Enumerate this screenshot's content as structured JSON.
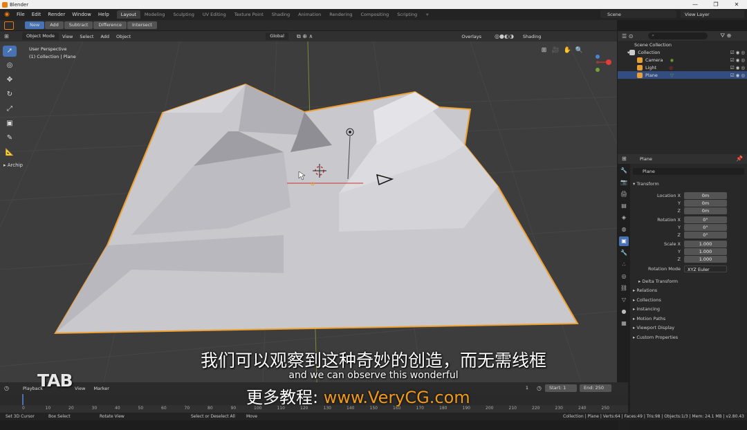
{
  "titlebar": {
    "app_title": "Blender",
    "min": "—",
    "max": "❐",
    "close": "✕"
  },
  "menu": [
    "File",
    "Edit",
    "Render",
    "Window",
    "Help"
  ],
  "workspaces": [
    {
      "label": "Layout",
      "active": true
    },
    {
      "label": "Modeling"
    },
    {
      "label": "Sculpting"
    },
    {
      "label": "UV Editing"
    },
    {
      "label": "Texture Point"
    },
    {
      "label": "Shading"
    },
    {
      "label": "Animation"
    },
    {
      "label": "Rendering"
    },
    {
      "label": "Compositing"
    },
    {
      "label": "Scripting"
    },
    {
      "label": "+"
    }
  ],
  "scene": {
    "label": "Scene",
    "view_layer": "View Layer"
  },
  "toolheader": {
    "buttons": [
      "New",
      "Add",
      "Subtract",
      "Difference",
      "Intersect"
    ]
  },
  "viewheader": {
    "mode": "Object Mode",
    "menus": [
      "View",
      "Select",
      "Add",
      "Object"
    ],
    "orientation": "Global",
    "overlays": "Overlays",
    "shading": "Shading"
  },
  "viewport": {
    "perspective": "User Perspective",
    "collection_line": "(1) Collection | Plane",
    "panel_label": "Archip"
  },
  "outliner": {
    "root": "Scene Collection",
    "collection": "Collection",
    "items": [
      {
        "name": "Camera",
        "color": "#e8a032"
      },
      {
        "name": "Light",
        "color": "#e8a032"
      },
      {
        "name": "Plane",
        "color": "#e8a032"
      }
    ]
  },
  "properties": {
    "object_name": "Plane",
    "data_name": "Plane",
    "transform_title": "Transform",
    "location": {
      "label": "Location X",
      "x": "0m",
      "y": "0m",
      "z": "0m"
    },
    "rotation": {
      "label": "Rotation X",
      "x": "0°",
      "y": "0°",
      "z": "0°"
    },
    "scale": {
      "label": "Scale X",
      "x": "1.000",
      "y": "1.000",
      "z": "1.000"
    },
    "axis_y": "Y",
    "axis_z": "Z",
    "rotation_mode_label": "Rotation Mode",
    "rotation_mode": "XYZ Euler",
    "delta": "Delta Transform",
    "sections": [
      "Relations",
      "Collections",
      "Instancing",
      "Motion Paths",
      "Viewport Display",
      "Custom Properties"
    ]
  },
  "timeline": {
    "menus": [
      "Playback",
      "View",
      "Marker"
    ],
    "frame": "1",
    "start": "Start:",
    "start_val": "1",
    "end": "End:",
    "end_val": "250",
    "ticks": [
      "0",
      "10",
      "20",
      "30",
      "40",
      "50",
      "60",
      "70",
      "80",
      "90",
      "100",
      "110",
      "120",
      "130",
      "140",
      "150",
      "160",
      "170",
      "180",
      "190",
      "200",
      "210",
      "220",
      "230",
      "240",
      "250"
    ]
  },
  "statusbar": {
    "set_cursor": "Set 3D Cursor",
    "box_select": "Box Select",
    "rotate_view": "Rotate View",
    "select": "Select or Deselect All",
    "move": "Move",
    "stats": "Collection | Plane | Verts:64 | Faces:49 | Tris:98 | Objects:1/3 | Mem: 24.1 MB | v2.80.43"
  },
  "subtitles": {
    "cn": "我们可以观察到这种奇妙的创造，而无需线框",
    "en": "and we can observe this wonderful"
  },
  "watermark": {
    "prefix": "更多教程: ",
    "url": "www.VeryCG.com",
    "logo": "TAB"
  }
}
